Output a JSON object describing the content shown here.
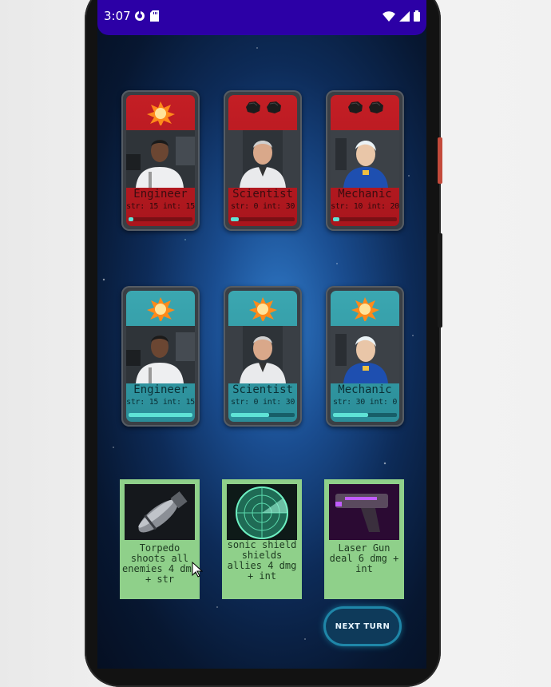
{
  "status_bar": {
    "time": "3:07",
    "color": "#2c00a6"
  },
  "enemy_cards": [
    {
      "role": "Engineer",
      "stats": "str: 15 int: 15",
      "status_icons": [
        "explosion-icon"
      ],
      "bar": 0.08
    },
    {
      "role": "Scientist",
      "stats": "str: 0 int: 30",
      "status_icons": [
        "rock-icon",
        "rock-icon"
      ],
      "bar": 0.12
    },
    {
      "role": "Mechanic",
      "stats": "str: 10 int: 20",
      "status_icons": [
        "rock-icon",
        "rock-icon"
      ],
      "bar": 0.1
    }
  ],
  "player_cards": [
    {
      "role": "Engineer",
      "stats": "str: 15 int: 15",
      "status_icons": [
        "explosion-icon"
      ],
      "bar": 1.0
    },
    {
      "role": "Scientist",
      "stats": "str: 0 int: 30",
      "status_icons": [
        "explosion-icon"
      ],
      "bar": 0.6
    },
    {
      "role": "Mechanic",
      "stats": "str: 30 int: 0",
      "status_icons": [
        "explosion-icon"
      ],
      "bar": 0.55
    }
  ],
  "items": [
    {
      "name": "torpedo-item",
      "text": "Torpedo shoots all enemies 4 dmg + str",
      "icon": "torpedo-icon"
    },
    {
      "name": "sonic-shield-item",
      "text": "sonic shield shields allies 4 dmg + int",
      "icon": "radar-icon"
    },
    {
      "name": "laser-gun-item",
      "text": "Laser Gun deal 6 dmg + int",
      "icon": "laser-gun-icon"
    }
  ],
  "next_turn_label": "NEXT TURN",
  "colors": {
    "enemy_card": "#c41e25",
    "player_card": "#3ba7b1",
    "item_bg": "#8fd08a",
    "bar_fill": "#5fe3d6"
  }
}
